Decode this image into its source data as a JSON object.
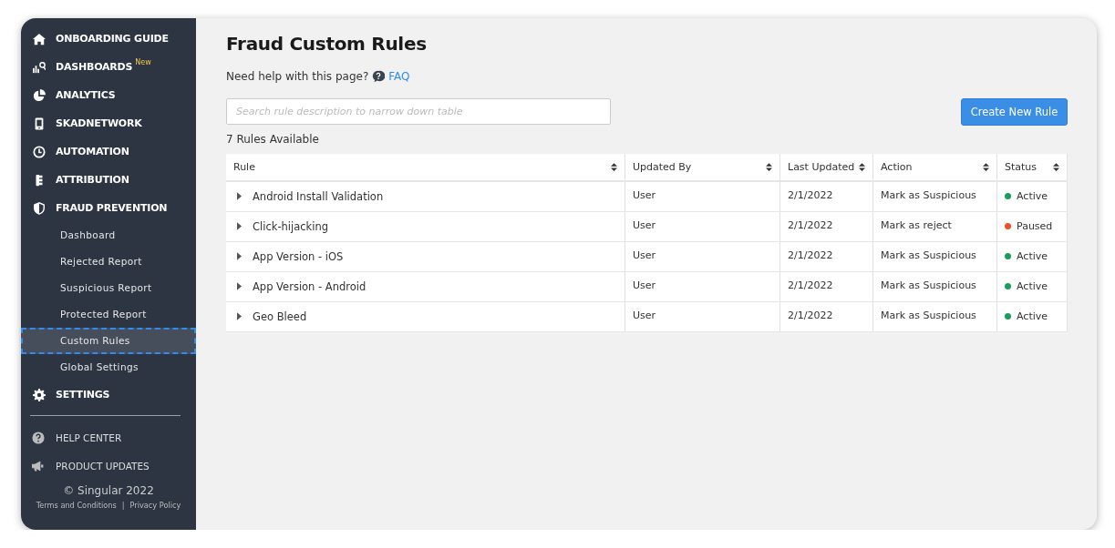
{
  "sidebar": {
    "items": [
      {
        "label": "ONBOARDING GUIDE",
        "selected": false
      },
      {
        "label": "DASHBOARDS",
        "badge": "New",
        "selected": false
      },
      {
        "label": "ANALYTICS",
        "selected": false
      },
      {
        "label": "SKADNETWORK",
        "selected": false
      },
      {
        "label": "AUTOMATION",
        "selected": false
      },
      {
        "label": "ATTRIBUTION",
        "selected": false
      },
      {
        "label": "FRAUD PREVENTION",
        "selected": false,
        "children": [
          {
            "label": "Dashboard",
            "selected": false
          },
          {
            "label": "Rejected Report",
            "selected": false
          },
          {
            "label": "Suspicious Report",
            "selected": false
          },
          {
            "label": "Protected Report",
            "selected": false
          },
          {
            "label": "Custom Rules",
            "selected": true
          },
          {
            "label": "Global Settings",
            "selected": false
          }
        ]
      },
      {
        "label": "SETTINGS",
        "selected": false
      }
    ],
    "links": [
      {
        "label": "HELP CENTER"
      },
      {
        "label": "PRODUCT UPDATES"
      }
    ],
    "copyright": "© Singular 2022",
    "footer_links": [
      "Terms and Conditions",
      "Privacy Policy"
    ],
    "separator": "|"
  },
  "page": {
    "title": "Fraud Custom Rules",
    "help_text": "Need help with this page?",
    "faq_link": "FAQ",
    "search": {
      "placeholder": "Search rule description to narrow down table"
    },
    "create_button": "Create New Rule",
    "count": "7 Rules Available"
  },
  "table": {
    "columns": [
      "Rule",
      "Updated By",
      "Last Updated",
      "Action",
      "Status"
    ],
    "rows": [
      {
        "rule": "Android Install Validation",
        "updated_by": "User",
        "last_updated": "2/1/2022",
        "action": "Mark as Suspicious",
        "status": "Active",
        "color": "#1a9e5c",
        "expanded": false
      },
      {
        "rule": "Click-hijacking",
        "updated_by": "User",
        "last_updated": "2/1/2022",
        "action": "Mark as reject",
        "status": "Paused",
        "color": "#f04e23",
        "expanded": false
      },
      {
        "rule": "App Version - iOS",
        "updated_by": "User",
        "last_updated": "2/1/2022",
        "action": "Mark as Suspicious",
        "status": "Active",
        "color": "#1a9e5c",
        "expanded": false
      },
      {
        "rule": "App Version - Android",
        "updated_by": "User",
        "last_updated": "2/1/2022",
        "action": "Mark as Suspicious",
        "status": "Active",
        "color": "#1a9e5c",
        "expanded": false
      },
      {
        "rule": "Geo Bleed",
        "updated_by": "User",
        "last_updated": "2/1/2022",
        "action": "Mark as Suspicious",
        "status": "Active",
        "color": "#1a9e5c",
        "expanded": false
      }
    ]
  }
}
